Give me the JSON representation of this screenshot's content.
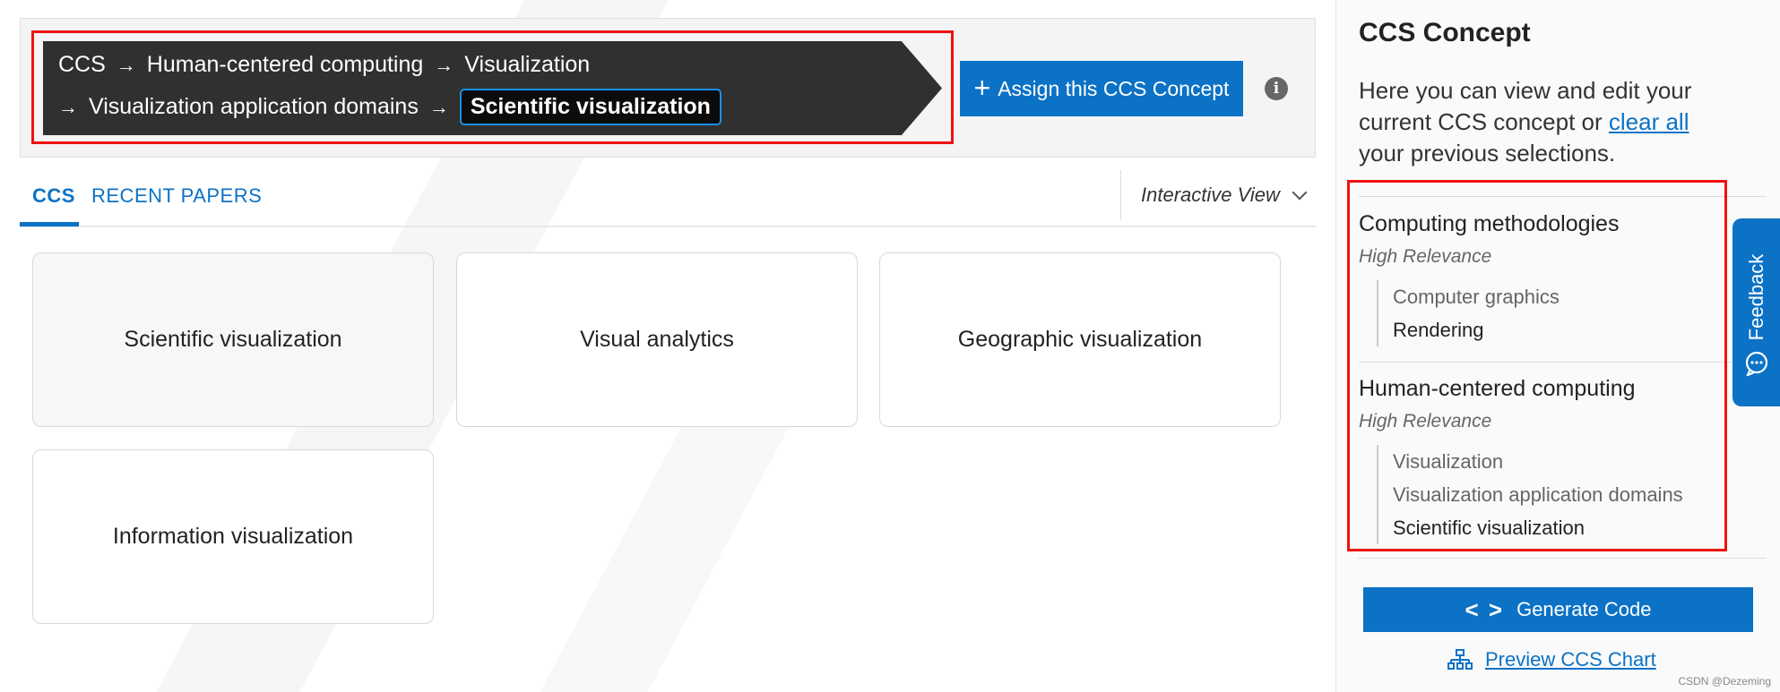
{
  "breadcrumb": {
    "line1": [
      "CCS",
      "Human-centered computing",
      "Visualization"
    ],
    "line2": [
      "Visualization application domains"
    ],
    "current": "Scientific visualization",
    "separator": "→"
  },
  "assign_button": {
    "icon": "plus-icon",
    "label": "Assign this CCS Concept"
  },
  "info_icon": "i",
  "tabs": [
    {
      "label": "CCS",
      "active": true
    },
    {
      "label": "RECENT PAPERS",
      "active": false
    }
  ],
  "view_select": {
    "label": "Interactive View"
  },
  "cards": [
    "Scientific visualization",
    "Visual analytics",
    "Geographic visualization",
    "Information visualization"
  ],
  "right_panel": {
    "title": "CCS Concept",
    "desc_before": "Here you can view and edit your current CCS concept or ",
    "desc_link": "clear all",
    "desc_after": " your previous selections.",
    "concepts": [
      {
        "name": "Computing methodologies",
        "relevance": "High Relevance",
        "path": [
          "Computer graphics",
          "Rendering"
        ]
      },
      {
        "name": "Human-centered computing",
        "relevance": "High Relevance",
        "path": [
          "Visualization",
          "Visualization application domains",
          "Scientific visualization"
        ]
      }
    ],
    "generate_button": {
      "icon": "code-icon",
      "code_glyph": "< >",
      "label": "Generate Code"
    },
    "preview_link": {
      "icon": "hierarchy-icon",
      "label": "Preview CCS Chart"
    }
  },
  "feedback_tab": {
    "label": "Feedback",
    "icon": "chat-bubble-icon"
  },
  "watermark": "CSDN @Dezeming",
  "colors": {
    "accent": "#0c72c6",
    "breadcrumb_bg": "#303030",
    "highlight_border": "#ee1111"
  }
}
